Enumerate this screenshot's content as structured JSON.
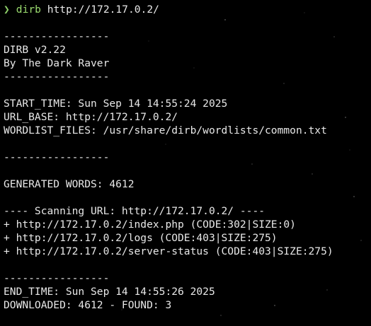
{
  "colors": {
    "background": "#000000",
    "text": "#e8e8e8",
    "prompt_arrow": "#8fd16a",
    "command_name": "#9bdc6f"
  },
  "prompt": {
    "symbol": "❯",
    "command": "dirb",
    "argument": " http://172.17.0.2/"
  },
  "output_lines": [
    "",
    "-----------------",
    "DIRB v2.22",
    "By The Dark Raver",
    "-----------------",
    "",
    "START_TIME: Sun Sep 14 14:55:24 2025",
    "URL_BASE: http://172.17.0.2/",
    "WORDLIST_FILES: /usr/share/dirb/wordlists/common.txt",
    "",
    "-----------------",
    "",
    "GENERATED WORDS: 4612",
    "",
    "---- Scanning URL: http://172.17.0.2/ ----",
    "+ http://172.17.0.2/index.php (CODE:302|SIZE:0)",
    "+ http://172.17.0.2/logs (CODE:403|SIZE:275)",
    "+ http://172.17.0.2/server-status (CODE:403|SIZE:275)",
    "",
    "-----------------",
    "END_TIME: Sun Sep 14 14:55:26 2025",
    "DOWNLOADED: 4612 - FOUND: 3"
  ]
}
